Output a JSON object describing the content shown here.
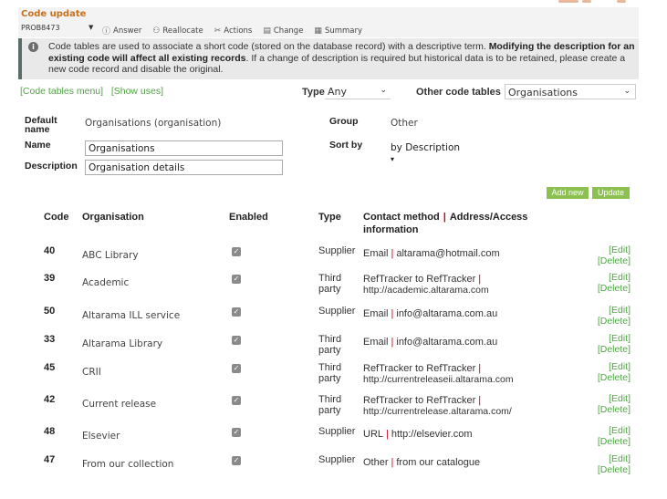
{
  "header": {
    "title": "Code update",
    "record_id": "PROB8473",
    "toolbar": [
      {
        "label": "Answer",
        "icon": "info-circle-icon",
        "glyph": "ⓘ"
      },
      {
        "label": "Reallocate",
        "icon": "people-icon",
        "glyph": "⚇"
      },
      {
        "label": "Actions",
        "icon": "wrench-icon",
        "glyph": "✂"
      },
      {
        "label": "Change",
        "icon": "document-icon",
        "glyph": "▤"
      },
      {
        "label": "Summary",
        "icon": "list-icon",
        "glyph": "▦"
      }
    ]
  },
  "banner": {
    "icon": "info-icon",
    "text_before": "Code tables are used to associate a short code (stored on the database record) with a descriptive term. ",
    "text_bold": "Modifying the description for an existing code will affect all existing records",
    "text_after": ". If a change of description is required but historical data is to be retained, please create a new code record and disable the original."
  },
  "links": {
    "code_tables_menu": "[Code tables menu]",
    "show_uses": "[Show uses]"
  },
  "filters": {
    "type_label": "Type",
    "type_value": "Any",
    "other_label": "Other code tables",
    "other_value": "Organisations"
  },
  "form": {
    "default_name_label": "Default name",
    "default_name_value": "Organisations (organisation)",
    "group_label": "Group",
    "group_value": "Other",
    "name_label": "Name",
    "name_value": "Organisations",
    "sort_label": "Sort by",
    "sort_value": "by Description",
    "description_label": "Description",
    "description_value": "Organisation details"
  },
  "buttons": {
    "add_new": "Add new",
    "update": "Update"
  },
  "table": {
    "headers": {
      "code": "Code",
      "organisation": "Organisation",
      "enabled": "Enabled",
      "type": "Type",
      "contact_a": "Contact method",
      "contact_b": "Address/Access",
      "contact_c": "information"
    },
    "edit_label": "[Edit]",
    "delete_label": "[Delete]",
    "rows": [
      {
        "code": "40",
        "organisation": "ABC Library",
        "enabled": true,
        "type": "Supplier",
        "method": "Email",
        "address": "altarama@hotmail.com"
      },
      {
        "code": "39",
        "organisation": "Academic",
        "enabled": true,
        "type": "Third party",
        "method": "RefTracker to RefTracker",
        "address": "http://academic.altarama.com"
      },
      {
        "code": "50",
        "organisation": "Altarama ILL service",
        "enabled": true,
        "type": "Supplier",
        "method": "Email",
        "address": "info@altarama.com.au"
      },
      {
        "code": "33",
        "organisation": "Altarama Library",
        "enabled": true,
        "type": "Third party",
        "method": "Email",
        "address": "info@altarama.com.au"
      },
      {
        "code": "45",
        "organisation": "CRII",
        "enabled": true,
        "type": "Third party",
        "method": "RefTracker to RefTracker",
        "address": "http://currentreleaseii.altarama.com"
      },
      {
        "code": "42",
        "organisation": "Current release",
        "enabled": true,
        "type": "Third party",
        "method": "RefTracker to RefTracker",
        "address": "http://currentrelease.altarama.com/"
      },
      {
        "code": "48",
        "organisation": "Elsevier",
        "enabled": true,
        "type": "Supplier",
        "method": "URL",
        "address": "http://elsevier.com"
      },
      {
        "code": "47",
        "organisation": "From our collection",
        "enabled": true,
        "type": "Supplier",
        "method": "Other",
        "address": "from our catalogue"
      }
    ]
  },
  "colors": {
    "title": "#c7701d",
    "link": "#52a447",
    "button": "#8cc152",
    "separator": "#d0021b"
  }
}
